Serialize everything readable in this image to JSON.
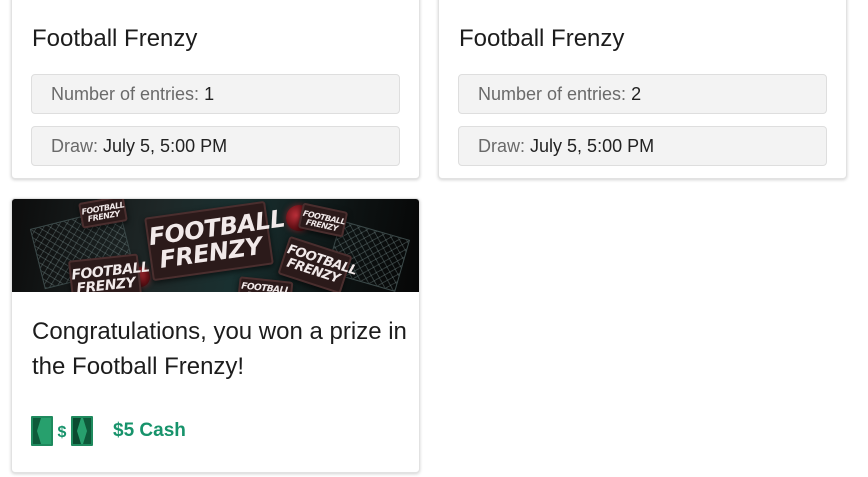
{
  "entry_cards": [
    {
      "title": "Football Frenzy",
      "entries_label": "Number of entries:",
      "entries_value": "1",
      "draw_label": "Draw:",
      "draw_value": "July 5, 5:00 PM"
    },
    {
      "title": "Football Frenzy",
      "entries_label": "Number of entries:",
      "entries_value": "2",
      "draw_label": "Draw:",
      "draw_value": "July 5, 5:00 PM"
    }
  ],
  "prize_card": {
    "banner": {
      "logo_line1": "FOOTBALL",
      "logo_line2": "FRENZY"
    },
    "message": "Congratulations, you won a prize in the Football Frenzy!",
    "prize_icon": "cash-bills-icon",
    "prize_label": "$5 Cash"
  },
  "colors": {
    "prize_accent": "#17936b",
    "card_border": "#e2e2e2",
    "info_box_background": "#f3f3f3",
    "banner_ticket": "#2b1a1a"
  }
}
